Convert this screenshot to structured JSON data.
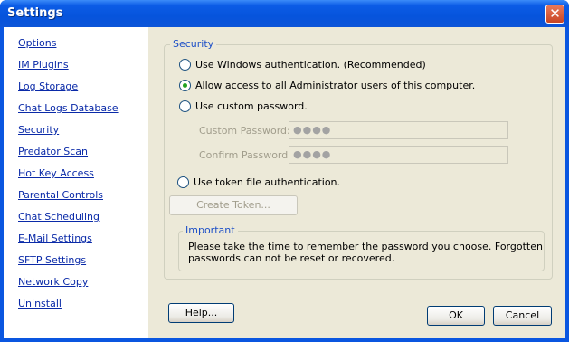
{
  "window": {
    "title": "Settings",
    "close_glyph": "✕"
  },
  "sidebar": {
    "items": [
      {
        "label": "Options"
      },
      {
        "label": "IM Plugins"
      },
      {
        "label": "Log Storage"
      },
      {
        "label": "Chat Logs Database"
      },
      {
        "label": "Security"
      },
      {
        "label": "Predator Scan"
      },
      {
        "label": "Hot Key Access"
      },
      {
        "label": "Parental Controls"
      },
      {
        "label": "Chat Scheduling"
      },
      {
        "label": "E-Mail Settings"
      },
      {
        "label": "SFTP Settings"
      },
      {
        "label": "Network Copy"
      },
      {
        "label": "Uninstall"
      }
    ]
  },
  "security": {
    "legend": "Security",
    "options": [
      {
        "label": "Use Windows authentication. (Recommended)",
        "checked": false
      },
      {
        "label": "Allow access to all Administrator users of this computer.",
        "checked": true
      },
      {
        "label": "Use custom password.",
        "checked": false
      },
      {
        "label": "Use token file authentication.",
        "checked": false
      }
    ],
    "custom_password_label": "Custom Password:",
    "custom_password_value": "●●●●",
    "confirm_password_label": "Confirm Password:",
    "confirm_password_value": "●●●●",
    "create_token_label": "Create Token..."
  },
  "important": {
    "legend": "Important",
    "line1": "Please take the time to remember the password you choose. Forgotten",
    "line2": "passwords can not be reset or recovered."
  },
  "buttons": {
    "help": "Help...",
    "ok": "OK",
    "cancel": "Cancel"
  },
  "colors": {
    "titlebar": "#0654dc",
    "link": "#0a2aa8",
    "legend": "#1c4fc7",
    "panel": "#ece9d8"
  }
}
